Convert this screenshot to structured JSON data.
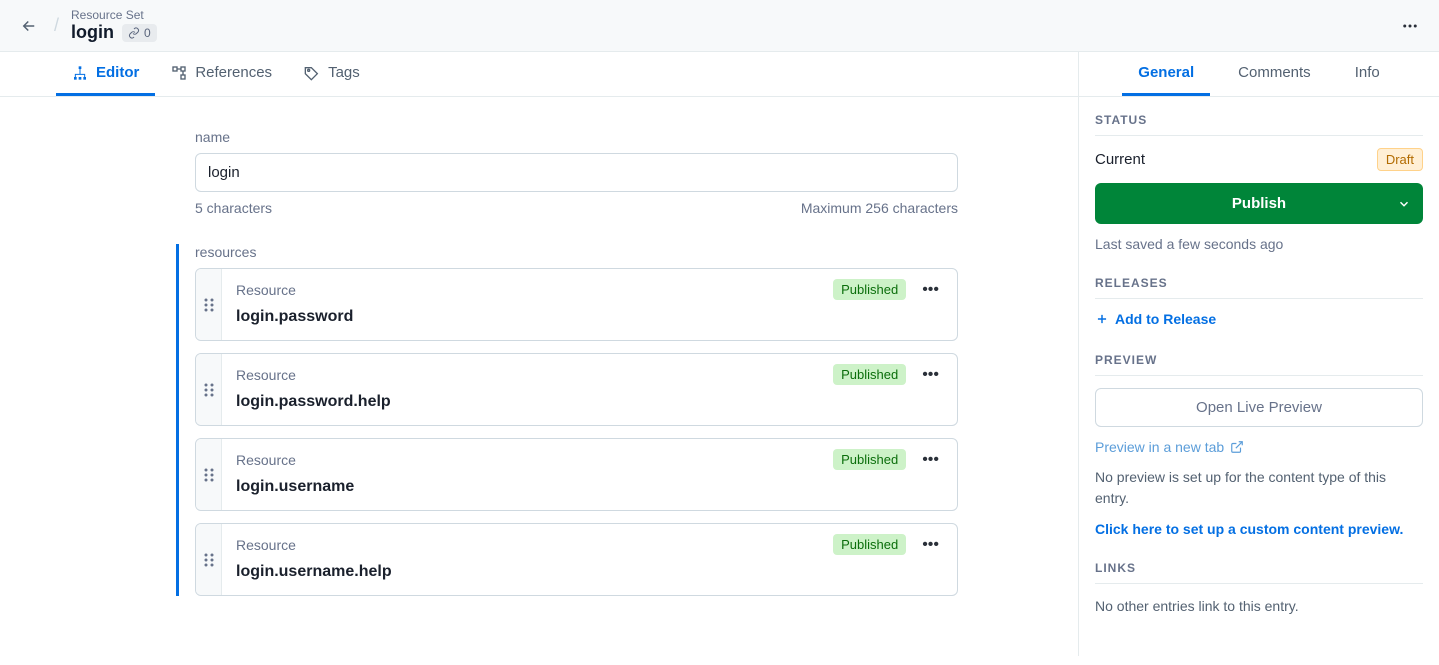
{
  "header": {
    "resource_type": "Resource Set",
    "title": "login",
    "link_count": "0"
  },
  "main_tabs": {
    "editor": "Editor",
    "references": "References",
    "tags": "Tags"
  },
  "side_tabs": {
    "general": "General",
    "comments": "Comments",
    "info": "Info"
  },
  "editor": {
    "name_label": "name",
    "name_value": "login",
    "char_count": "5 characters",
    "char_max": "Maximum 256 characters",
    "resources_label": "resources",
    "resource_type_label": "Resource",
    "items": [
      {
        "title": "login.password",
        "status": "Published"
      },
      {
        "title": "login.password.help",
        "status": "Published"
      },
      {
        "title": "login.username",
        "status": "Published"
      },
      {
        "title": "login.username.help",
        "status": "Published"
      }
    ]
  },
  "sidebar": {
    "status_heading": "STATUS",
    "current_label": "Current",
    "current_badge": "Draft",
    "publish_label": "Publish",
    "last_saved": "Last saved a few seconds ago",
    "releases_heading": "RELEASES",
    "add_release": "Add to Release",
    "preview_heading": "PREVIEW",
    "open_preview": "Open Live Preview",
    "preview_new_tab": "Preview in a new tab",
    "no_preview": "No preview is set up for the content type of this entry.",
    "setup_preview": "Click here to set up a custom content preview.",
    "links_heading": "LINKS",
    "no_links": "No other entries link to this entry."
  }
}
